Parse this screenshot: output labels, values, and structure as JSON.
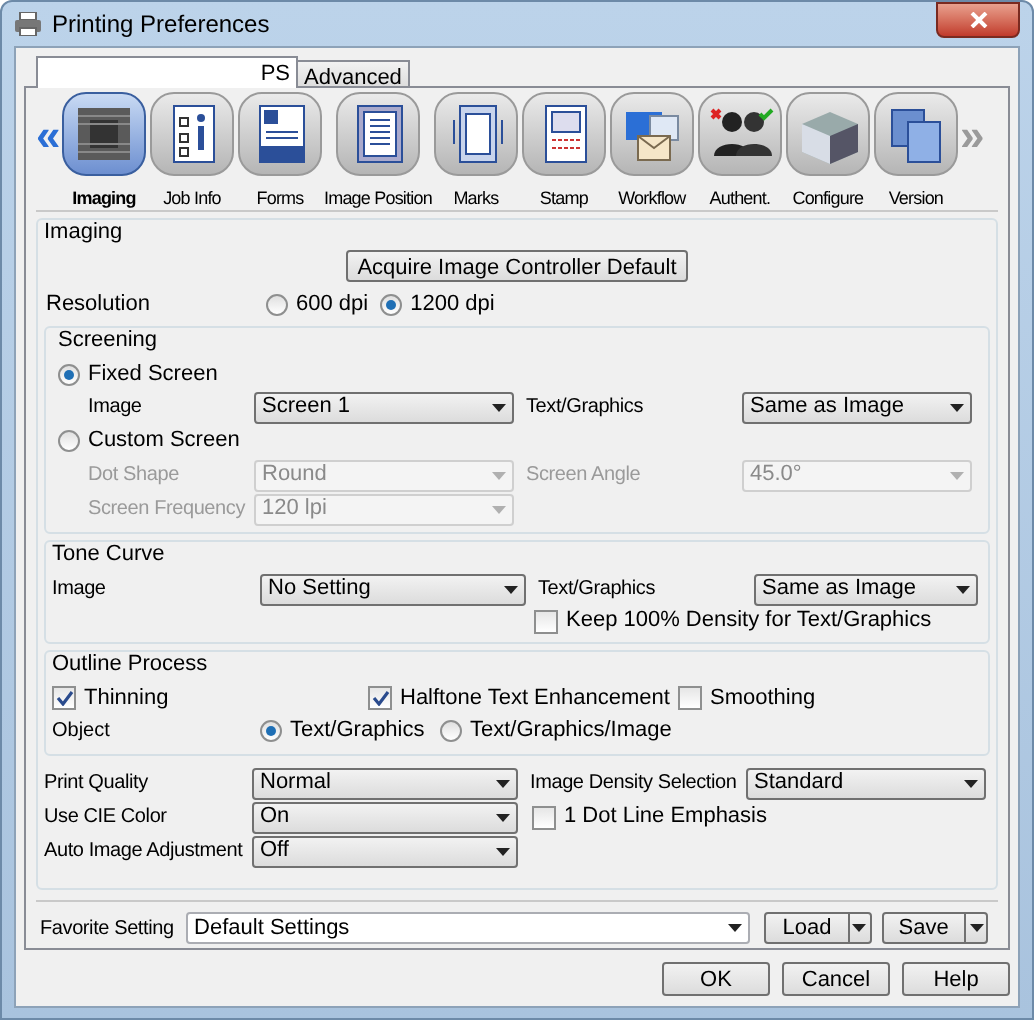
{
  "window": {
    "title": "Printing Preferences"
  },
  "tabs": [
    {
      "label": "PS",
      "selected": true
    },
    {
      "label": "Advanced",
      "selected": false
    }
  ],
  "toolbar": {
    "prev": {
      "glyph": "«",
      "disabled": false
    },
    "next": {
      "glyph": "»",
      "disabled": true
    },
    "items": [
      {
        "label": "Imaging",
        "selected": true
      },
      {
        "label": "Job Info",
        "selected": false
      },
      {
        "label": "Forms",
        "selected": false
      },
      {
        "label": "Image Position",
        "selected": false
      },
      {
        "label": "Marks",
        "selected": false
      },
      {
        "label": "Stamp",
        "selected": false
      },
      {
        "label": "Workflow",
        "selected": false
      },
      {
        "label": "Authent.",
        "selected": false
      },
      {
        "label": "Configure",
        "selected": false
      },
      {
        "label": "Version",
        "selected": false
      }
    ]
  },
  "imaging": {
    "title": "Imaging",
    "acquire_button": "Acquire Image Controller Default",
    "resolution": {
      "label": "Resolution",
      "options": [
        {
          "label": "600 dpi",
          "selected": false
        },
        {
          "label": "1200 dpi",
          "selected": true
        }
      ]
    },
    "screening": {
      "title": "Screening",
      "fixed_screen": {
        "label": "Fixed Screen",
        "selected": true
      },
      "image": {
        "label": "Image",
        "value": "Screen 1",
        "disabled": false
      },
      "text_graphics": {
        "label": "Text/Graphics",
        "value": "Same as Image",
        "disabled": false
      },
      "custom_screen": {
        "label": "Custom Screen",
        "selected": false
      },
      "dot_shape": {
        "label": "Dot Shape",
        "value": "Round",
        "disabled": true
      },
      "screen_angle": {
        "label": "Screen Angle",
        "value": "45.0°",
        "disabled": true
      },
      "screen_frequency": {
        "label": "Screen Frequency",
        "value": "120 lpi",
        "disabled": true
      }
    },
    "tone_curve": {
      "title": "Tone Curve",
      "image": {
        "label": "Image",
        "value": "No Setting",
        "disabled": false
      },
      "text_graphics": {
        "label": "Text/Graphics",
        "value": "Same as Image",
        "disabled": false
      },
      "keep_density": {
        "label": "Keep 100% Density for Text/Graphics",
        "checked": false
      }
    },
    "outline_process": {
      "title": "Outline Process",
      "thinning": {
        "label": "Thinning",
        "checked": true
      },
      "halftone": {
        "label": "Halftone Text Enhancement",
        "checked": true
      },
      "smoothing": {
        "label": "Smoothing",
        "checked": false
      },
      "object": {
        "label": "Object",
        "options": [
          {
            "label": "Text/Graphics",
            "selected": true
          },
          {
            "label": "Text/Graphics/Image",
            "selected": false
          }
        ]
      }
    },
    "print_quality": {
      "label": "Print Quality",
      "value": "Normal",
      "disabled": false
    },
    "image_density": {
      "label": "Image Density Selection",
      "value": "Standard",
      "disabled": false
    },
    "use_cie": {
      "label": "Use CIE Color",
      "value": "On",
      "disabled": false
    },
    "dot_line": {
      "label": "1 Dot Line Emphasis",
      "checked": false
    },
    "auto_image": {
      "label": "Auto Image Adjustment",
      "value": "Off",
      "disabled": false
    }
  },
  "favorite": {
    "label": "Favorite Setting",
    "value": "Default Settings",
    "load": "Load",
    "save": "Save"
  },
  "buttons": [
    "OK",
    "Cancel",
    "Help"
  ]
}
